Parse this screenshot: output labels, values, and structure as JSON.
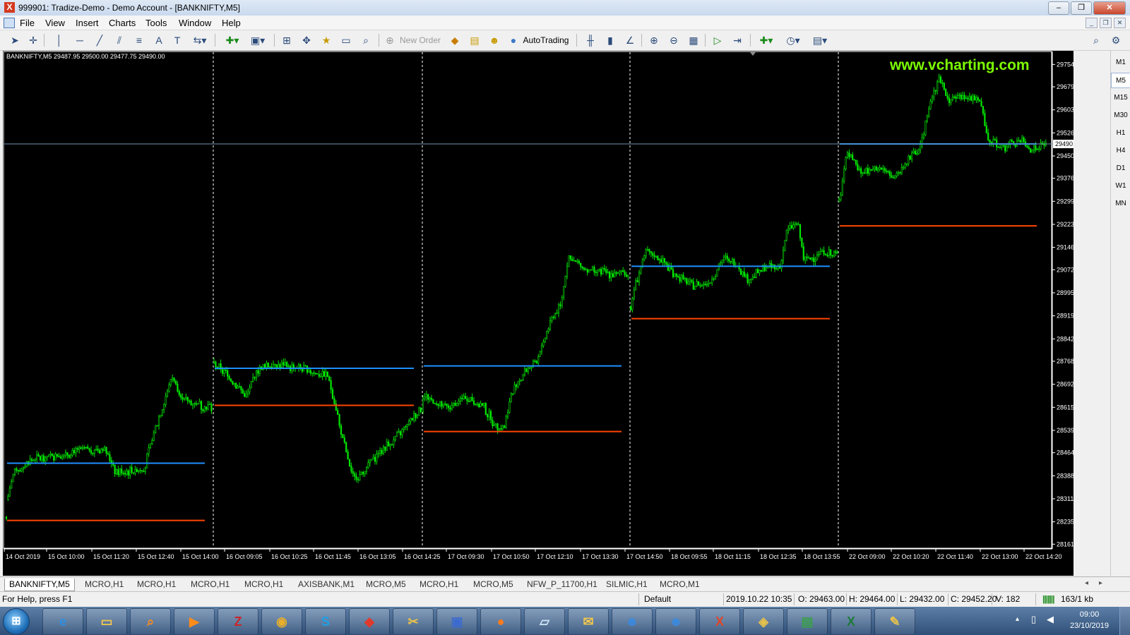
{
  "window": {
    "title": "999901: Tradize-Demo - Demo Account - [BANKNIFTY,M5]",
    "minimize": "–",
    "restore": "❐",
    "close": "✕"
  },
  "menu": {
    "file": "File",
    "view": "View",
    "insert": "Insert",
    "charts": "Charts",
    "tools": "Tools",
    "window": "Window",
    "help": "Help"
  },
  "toolbar": {
    "new_order": "New Order",
    "autotrading": "AutoTrading"
  },
  "chart": {
    "info": "BANKNIFTY,M5  29487.95 29500.00 29477.75 29490.00",
    "watermark": "www.vcharting.com",
    "price_labels": [
      "29754.05",
      "29679.80",
      "29603.30",
      "29526.80",
      "29450.30",
      "29376.05",
      "29299.55",
      "29223.05",
      "29146.55",
      "29072.30",
      "28995.80",
      "28919.30",
      "28842.80",
      "28768.55",
      "28692.05",
      "28615.55",
      "28539.05",
      "28464.80",
      "28388.30",
      "28311.80",
      "28235.30",
      "28161.05"
    ],
    "current_price": "29490.00",
    "time_labels": [
      "14 Oct 2019",
      "15 Oct 10:00",
      "15 Oct 11:20",
      "15 Oct 12:40",
      "15 Oct 14:00",
      "16 Oct 09:05",
      "16 Oct 10:25",
      "16 Oct 11:45",
      "16 Oct 13:05",
      "16 Oct 14:25",
      "17 Oct 09:30",
      "17 Oct 10:50",
      "17 Oct 12:10",
      "17 Oct 13:30",
      "17 Oct 14:50",
      "18 Oct 09:55",
      "18 Oct 11:15",
      "18 Oct 12:35",
      "18 Oct 13:55",
      "22 Oct 09:00",
      "22 Oct 10:20",
      "22 Oct 11:40",
      "22 Oct 13:00",
      "22 Oct 14:20"
    ],
    "colors": {
      "background": "#000000",
      "candles": "#00e600",
      "blue_level": "#1e90ff",
      "red_level": "#ff4500",
      "watermark": "#7cfc00",
      "grid_separator": "#ffffff"
    },
    "session_levels": [
      {
        "session": "14 Oct",
        "blue": 28430,
        "red": 28240
      },
      {
        "session": "16 Oct",
        "blue": 28745,
        "red": 28622
      },
      {
        "session": "17 Oct",
        "blue": 28753,
        "red": 28535
      },
      {
        "session": "18 Oct",
        "blue": 29084,
        "red": 28910
      },
      {
        "session": "22 Oct",
        "blue": 29490,
        "red": 29218
      }
    ]
  },
  "timeframes": [
    "M1",
    "M5",
    "M15",
    "M30",
    "H1",
    "H4",
    "D1",
    "W1",
    "MN"
  ],
  "tabs": [
    "BANKNIFTY,M5",
    "MCRO,H1",
    "MCRO,H1",
    "MCRO,H1",
    "MCRO,H1",
    "AXISBANK,M1",
    "MCRO,M5",
    "MCRO,H1",
    "MCRO,M5",
    "NFW_P_11700,H1",
    "SILMIC,H1",
    "MCRO,M1"
  ],
  "status": {
    "help": "For Help, press F1",
    "profile": "Default",
    "datetime": "2019.10.22 10:35",
    "open": "O: 29463.00",
    "high": "H: 29464.00",
    "low": "L: 29432.00",
    "close": "C: 29452.20",
    "volume": "V: 182",
    "connection": "163/1 kb"
  },
  "taskbar": {
    "time": "09:00",
    "date": "23/10/2019"
  }
}
